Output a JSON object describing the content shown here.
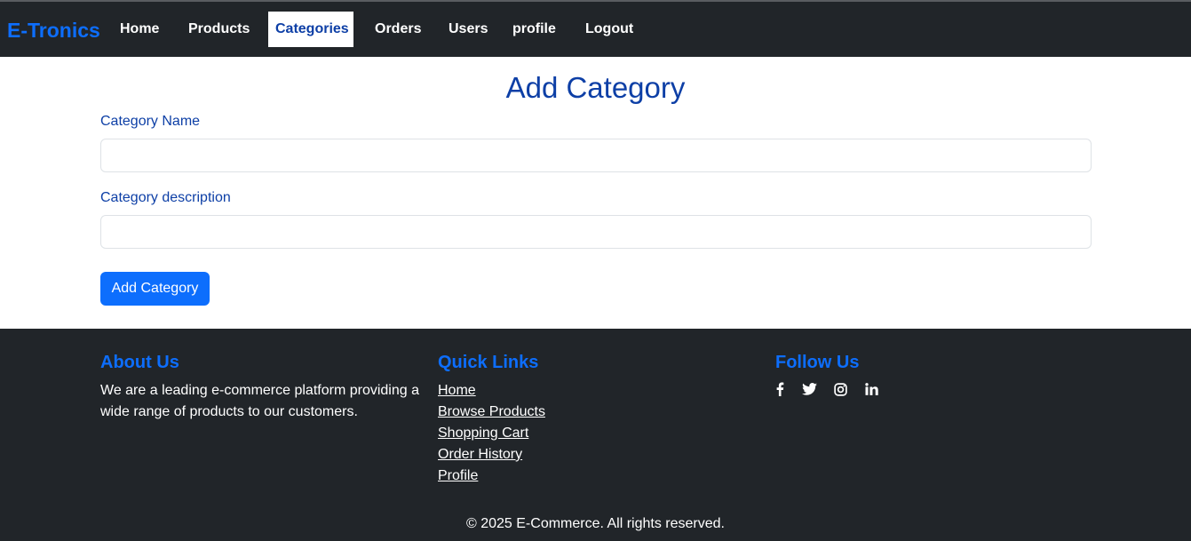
{
  "brand": "E-Tronics",
  "nav": {
    "items": [
      {
        "label": "Home"
      },
      {
        "label": "Products"
      },
      {
        "label": "Categories",
        "active": true
      },
      {
        "label": "Orders"
      },
      {
        "label": "Users"
      },
      {
        "label": "profile"
      },
      {
        "label": "Logout"
      }
    ]
  },
  "form": {
    "title": "Add Category",
    "name_label": "Category Name",
    "name_value": "",
    "description_label": "Category description",
    "description_value": "",
    "submit_label": "Add Category"
  },
  "footer": {
    "about_heading": "About Us",
    "about_text": "We are a leading e-commerce platform providing a wide range of products to our customers.",
    "links_heading": "Quick Links",
    "links": [
      "Home",
      "Browse Products",
      "Shopping Cart",
      "Order History",
      "Profile"
    ],
    "follow_heading": "Follow Us",
    "social_icons": [
      "facebook-icon",
      "twitter-icon",
      "instagram-icon",
      "linkedin-icon"
    ],
    "copyright": "© 2025 E-Commerce. All rights reserved."
  },
  "colors": {
    "navbar_bg": "#212529",
    "brand": "#0d6efd",
    "title": "#0d3fa6",
    "button": "#0d6efd"
  }
}
